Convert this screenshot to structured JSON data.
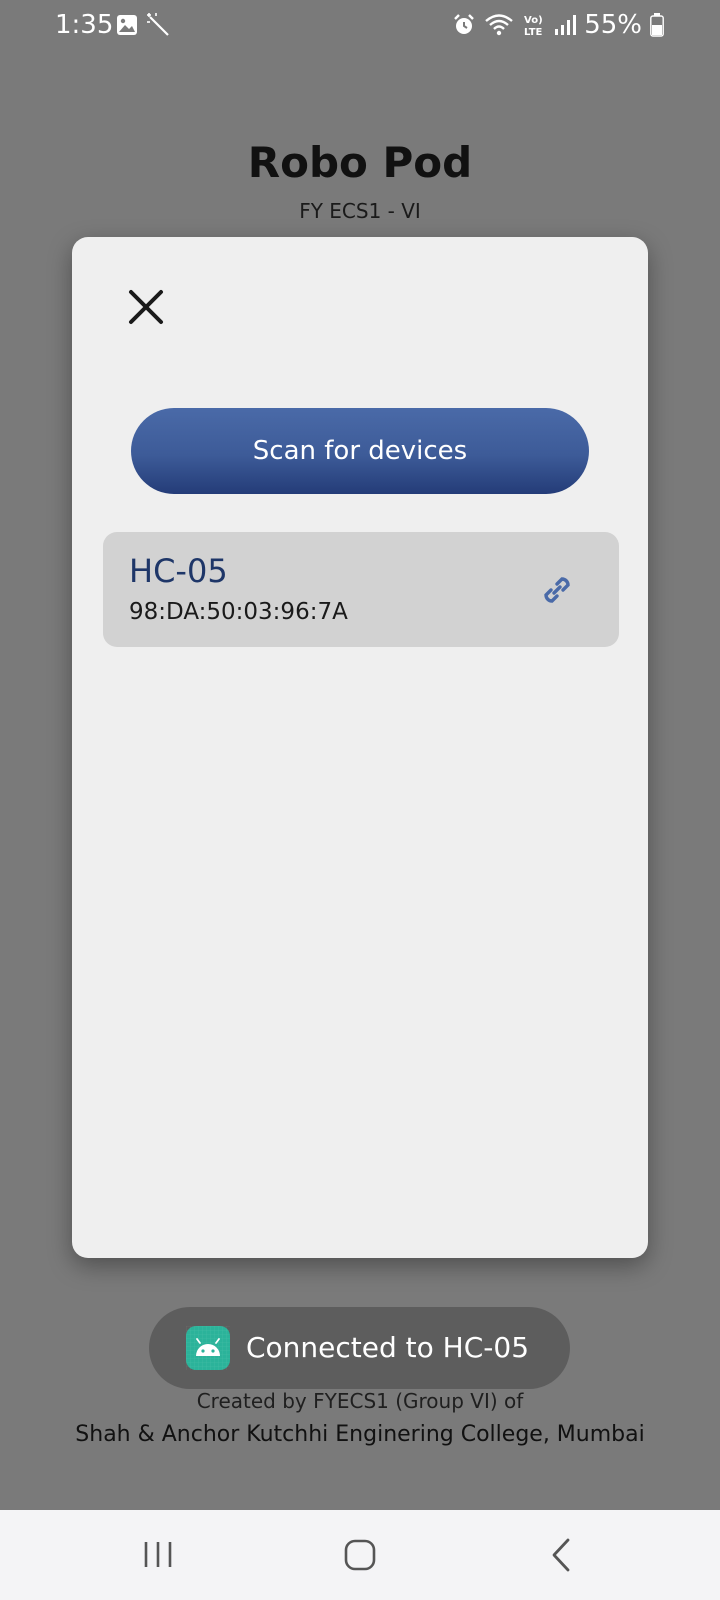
{
  "status_bar": {
    "time": "1:35",
    "battery_percent": "55%",
    "left_icons": [
      "gallery-icon",
      "magic-wand-icon"
    ],
    "right_icons": [
      "alarm-icon",
      "wifi-icon",
      "volte-icon",
      "signal-icon",
      "battery-icon"
    ],
    "volte_label_top": "Vo)",
    "volte_label_bottom": "LTE"
  },
  "app": {
    "title": "Robo Pod",
    "subtitle": "FY ECS1 - VI"
  },
  "modal": {
    "close_icon": "close-icon",
    "scan_button_label": "Scan for devices",
    "devices": [
      {
        "name": "HC-05",
        "address": "98:DA:50:03:96:7A",
        "action_icon": "link-icon"
      }
    ]
  },
  "toast": {
    "icon": "android-icon",
    "message": "Connected to HC-05"
  },
  "footer": {
    "credit_line_1": "Created by FYECS1 (Group VI) of",
    "credit_line_2": "Shah & Anchor Kutchhi Enginering College, Mumbai"
  },
  "nav_bar": {
    "items": [
      "recent-apps-icon",
      "home-icon",
      "back-icon"
    ]
  },
  "colors": {
    "scrim": "#7a7a7a",
    "modal_bg": "#efefef",
    "scan_button": "#3d5b98",
    "device_name": "#1e3668",
    "device_card": "#d2d2d2",
    "link_icon": "#4a6aa8",
    "toast_bg": "#5d5d5d",
    "android_icon_bg": "#2bb39a"
  }
}
